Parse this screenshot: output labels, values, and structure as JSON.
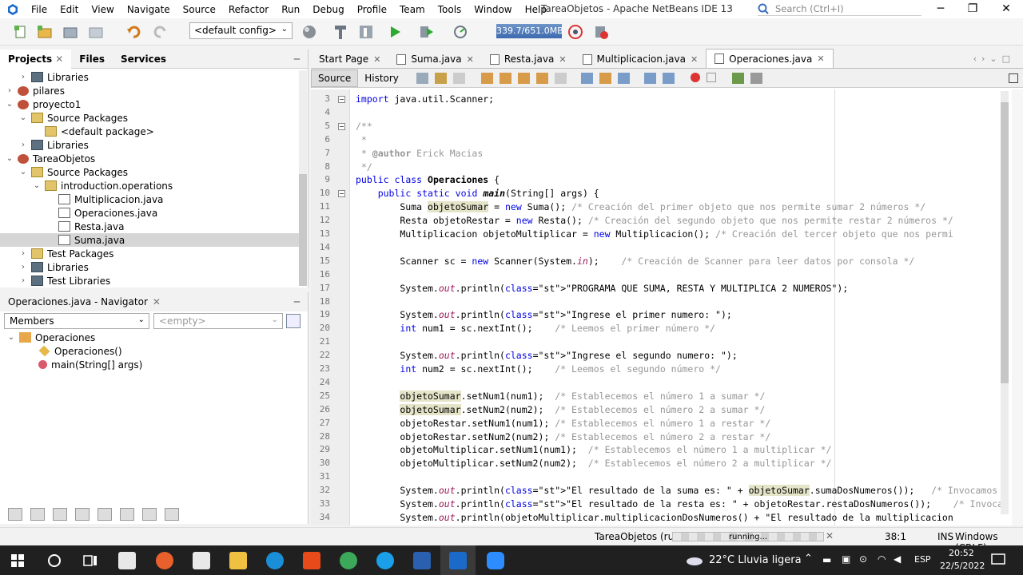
{
  "app": {
    "window_title": "TareaObjetos - Apache NetBeans IDE 13",
    "menu": [
      "File",
      "Edit",
      "View",
      "Navigate",
      "Source",
      "Refactor",
      "Run",
      "Debug",
      "Profile",
      "Team",
      "Tools",
      "Window",
      "Help"
    ],
    "search_placeholder": "Search (Ctrl+I)"
  },
  "toolbar": {
    "config": "<default config>",
    "memory": "339.7/651.0MB"
  },
  "projects_panel": {
    "tabs": [
      "Projects",
      "Files",
      "Services"
    ],
    "tree": [
      {
        "label": "Libraries",
        "icon": "library-icon",
        "indent": 2,
        "exp": "+"
      },
      {
        "label": "pilares",
        "icon": "project-icon",
        "indent": 1,
        "exp": "+"
      },
      {
        "label": "proyecto1",
        "icon": "project-icon",
        "indent": 1,
        "exp": "-"
      },
      {
        "label": "Source Packages",
        "icon": "package-folder-icon",
        "indent": 2,
        "exp": "-"
      },
      {
        "label": "<default package>",
        "icon": "package-icon",
        "indent": 3,
        "exp": ""
      },
      {
        "label": "Libraries",
        "icon": "library-icon",
        "indent": 2,
        "exp": "+"
      },
      {
        "label": "TareaObjetos",
        "icon": "project-icon",
        "indent": 1,
        "exp": "-"
      },
      {
        "label": "Source Packages",
        "icon": "package-folder-icon",
        "indent": 2,
        "exp": "-"
      },
      {
        "label": "introduction.operations",
        "icon": "package-icon",
        "indent": 3,
        "exp": "-"
      },
      {
        "label": "Multiplicacion.java",
        "icon": "java-file-icon",
        "indent": 4,
        "exp": ""
      },
      {
        "label": "Operaciones.java",
        "icon": "java-file-icon",
        "indent": 4,
        "exp": ""
      },
      {
        "label": "Resta.java",
        "icon": "java-file-icon",
        "indent": 4,
        "exp": ""
      },
      {
        "label": "Suma.java",
        "icon": "java-file-icon",
        "indent": 4,
        "exp": "",
        "selected": true
      },
      {
        "label": "Test Packages",
        "icon": "package-folder-icon",
        "indent": 2,
        "exp": "+"
      },
      {
        "label": "Libraries",
        "icon": "library-icon",
        "indent": 2,
        "exp": "+"
      },
      {
        "label": "Test Libraries",
        "icon": "library-icon",
        "indent": 2,
        "exp": "+"
      }
    ]
  },
  "navigator": {
    "title": "Operaciones.java - Navigator",
    "members_select": "Members",
    "filter_select": "<empty>",
    "items": [
      {
        "label": "Operaciones",
        "indent": 0
      },
      {
        "label": "Operaciones()",
        "indent": 1
      },
      {
        "label": "main(String[] args)",
        "indent": 1
      }
    ]
  },
  "editor": {
    "tabs": [
      {
        "label": "Start Page",
        "selected": false
      },
      {
        "label": "Suma.java",
        "selected": false
      },
      {
        "label": "Resta.java",
        "selected": false
      },
      {
        "label": "Multiplicacion.java",
        "selected": false
      },
      {
        "label": "Operaciones.java",
        "selected": true
      }
    ],
    "subtabs": [
      "Source",
      "History"
    ],
    "lines": [
      {
        "n": "3",
        "t": "import java.util.Scanner;"
      },
      {
        "n": "4",
        "t": ""
      },
      {
        "n": "5",
        "t": "/**"
      },
      {
        "n": "6",
        "t": " *"
      },
      {
        "n": "7",
        "t": " * @author Erick Macias"
      },
      {
        "n": "8",
        "t": " */"
      },
      {
        "n": "9",
        "t": "public class Operaciones {"
      },
      {
        "n": "10",
        "t": "    public static void main(String[] args) {"
      },
      {
        "n": "11",
        "t": "        Suma objetoSumar = new Suma(); /* Creación del primer objeto que nos permite sumar 2 números */"
      },
      {
        "n": "12",
        "t": "        Resta objetoRestar = new Resta(); /* Creación del segundo objeto que nos permite restar 2 números */"
      },
      {
        "n": "13",
        "t": "        Multiplicacion objetoMultiplicar = new Multiplicacion(); /* Creación del tercer objeto que nos permi"
      },
      {
        "n": "14",
        "t": ""
      },
      {
        "n": "15",
        "t": "        Scanner sc = new Scanner(System.in);    /* Creación de Scanner para leer datos por consola */"
      },
      {
        "n": "16",
        "t": ""
      },
      {
        "n": "17",
        "t": "        System.out.println(\"PROGRAMA QUE SUMA, RESTA Y MULTIPLICA 2 NUMEROS\");"
      },
      {
        "n": "18",
        "t": ""
      },
      {
        "n": "19",
        "t": "        System.out.println(\"Ingrese el primer numero: \");"
      },
      {
        "n": "20",
        "t": "        int num1 = sc.nextInt();    /* Leemos el primer número */"
      },
      {
        "n": "21",
        "t": ""
      },
      {
        "n": "22",
        "t": "        System.out.println(\"Ingrese el segundo numero: \");"
      },
      {
        "n": "23",
        "t": "        int num2 = sc.nextInt();    /* Leemos el segundo número */"
      },
      {
        "n": "24",
        "t": ""
      },
      {
        "n": "25",
        "t": "        objetoSumar.setNum1(num1);  /* Establecemos el número 1 a sumar */"
      },
      {
        "n": "26",
        "t": "        objetoSumar.setNum2(num2);  /* Establecemos el número 2 a sumar */"
      },
      {
        "n": "27",
        "t": "        objetoRestar.setNum1(num1); /* Establecemos el número 1 a restar */"
      },
      {
        "n": "28",
        "t": "        objetoRestar.setNum2(num2); /* Establecemos el número 2 a restar */"
      },
      {
        "n": "29",
        "t": "        objetoMultiplicar.setNum1(num1);  /* Establecemos el número 1 a multiplicar */"
      },
      {
        "n": "30",
        "t": "        objetoMultiplicar.setNum2(num2);  /* Establecemos el número 2 a multiplicar */"
      },
      {
        "n": "31",
        "t": ""
      },
      {
        "n": "32",
        "t": "        System.out.println(\"El resultado de la suma es: \" + objetoSumar.sumaDosNumeros());   /* Invocamos y"
      },
      {
        "n": "33",
        "t": "        System.out.println(\"El resultado de la resta es: \" + objetoRestar.restaDosNumeros());    /* Invocamo"
      },
      {
        "n": "34",
        "t": "        System.out.println(objetoMultiplicar.multiplicacionDosNumeros() + \"El resultado de la multiplicacion"
      }
    ]
  },
  "status": {
    "run_label": "TareaObjetos (run)",
    "progress_text": "running...",
    "position": "38:1",
    "mode": "INS",
    "line_endings": "Windows (CRLF)"
  },
  "taskbar": {
    "weather": "22°C  Lluvia ligera",
    "lang": "ESP",
    "time": "20:52",
    "date": "22/5/2022"
  }
}
